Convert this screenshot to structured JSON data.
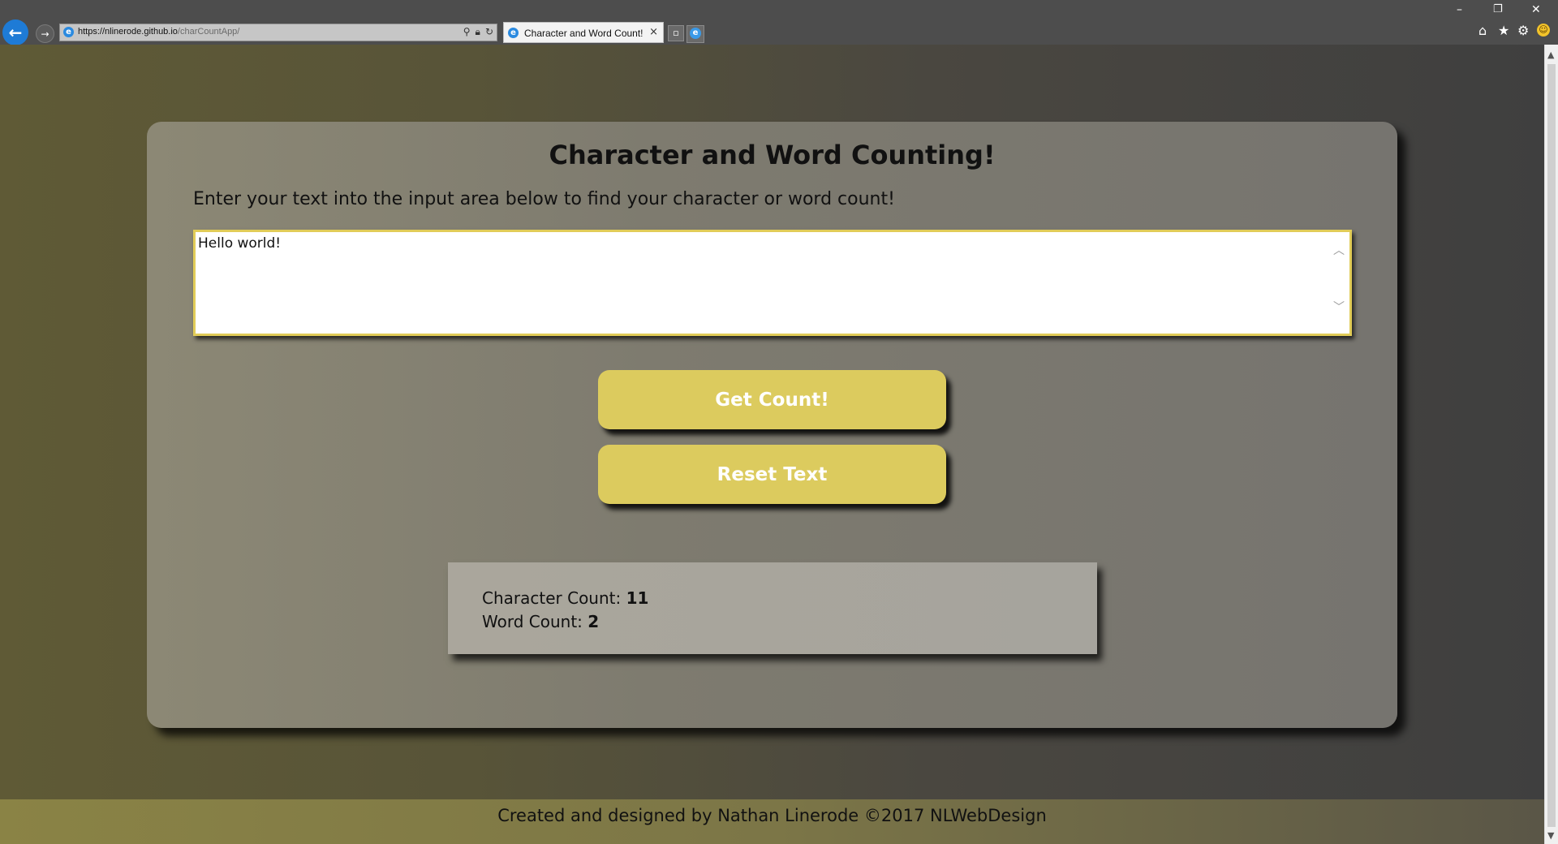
{
  "browser": {
    "url_host": "https://nlinerode.github.io",
    "url_path": "/charCountApp/",
    "tab_title": "Character and Word Count!",
    "tab_close": "×",
    "window_controls": {
      "minimize": "–",
      "restore": "❐",
      "close": "✕"
    },
    "toolbar_icons": [
      "home-icon",
      "star-icon",
      "gear-icon",
      "smiley-icon"
    ]
  },
  "page": {
    "title": "Character and Word Counting!",
    "instructions": "Enter your text into the input area below to find your character or word count!",
    "input_value": "Hello world!",
    "buttons": {
      "get_count": "Get Count!",
      "reset": "Reset Text"
    },
    "results": {
      "char_label": "Character Count: ",
      "char_value": "11",
      "word_label": "Word Count: ",
      "word_value": "2"
    },
    "footer": "Created and designed by Nathan Linerode ©2017 NLWebDesign"
  },
  "colors": {
    "button": "#dccb5e",
    "input_border": "#e1cc58",
    "accent_blue": "#1e7bd6"
  }
}
